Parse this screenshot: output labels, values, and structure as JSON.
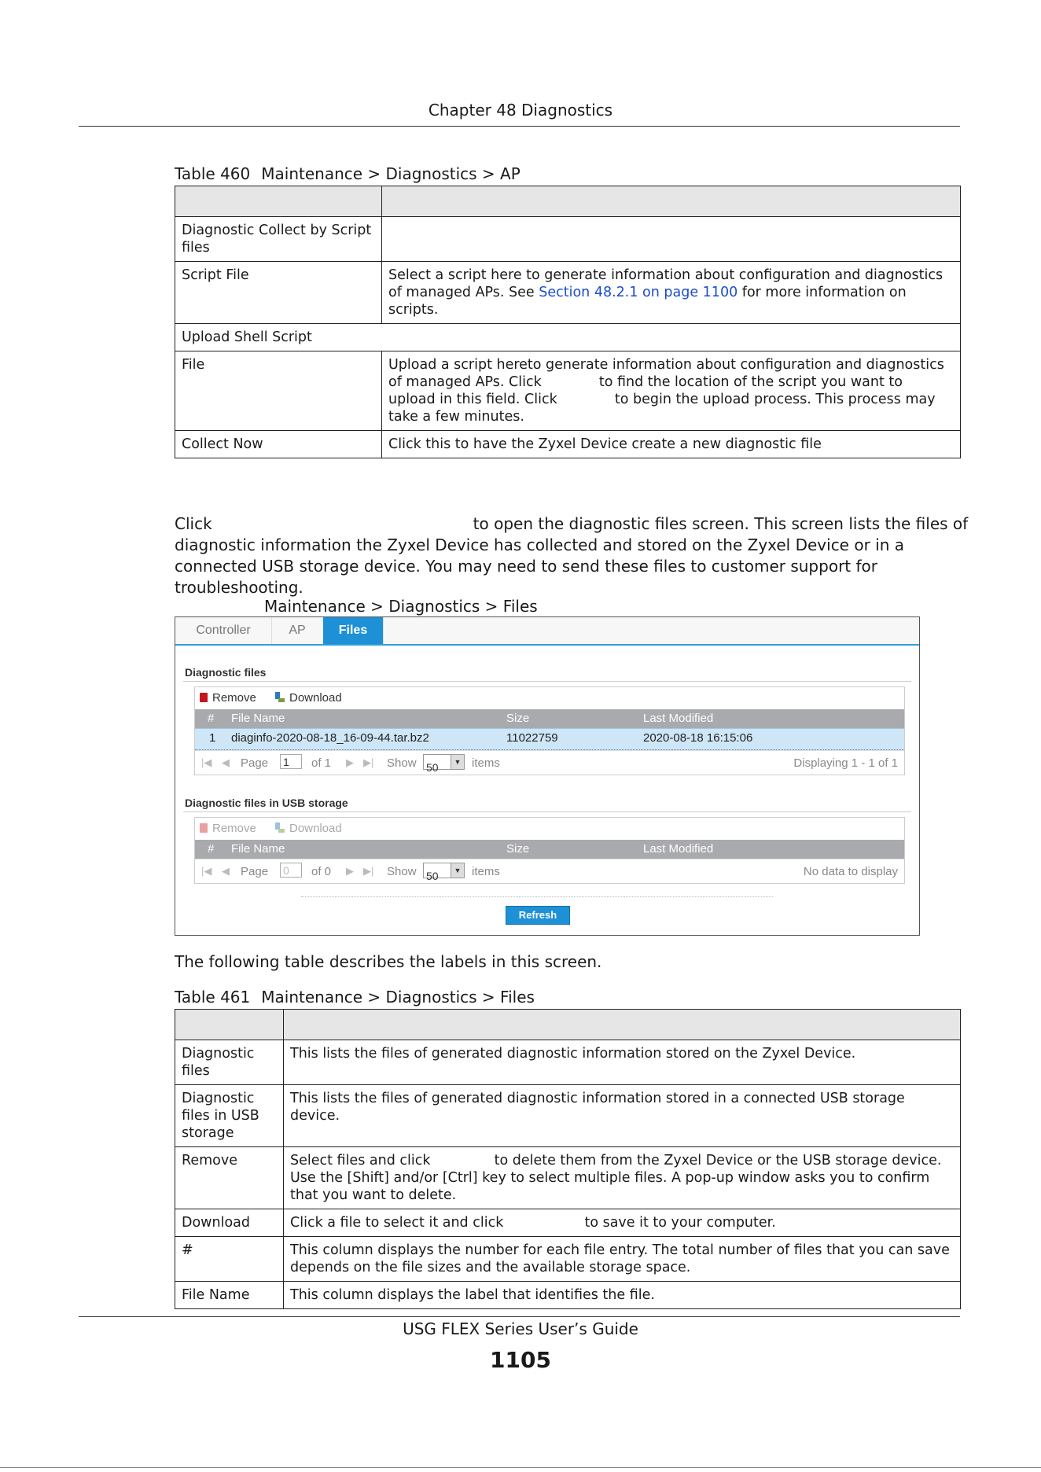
{
  "header": {
    "chapter_title": "Chapter 48 Diagnostics"
  },
  "table460": {
    "caption_num": "Table 460",
    "caption_title": "Maintenance > Diagnostics > AP",
    "rows": [
      {
        "label": "Diagnostic Collect by Script files",
        "desc": ""
      },
      {
        "label": "Script File",
        "desc_pre": "Select a script here to generate information about configuration and diagnostics of managed APs. See ",
        "link": "Section 48.2.1 on page 1100",
        "desc_post": " for more information on scripts."
      },
      {
        "label": "Upload Shell Script"
      },
      {
        "label": "File",
        "desc_a": "Upload a script hereto generate information about configuration and diagnostics of managed APs. Click ",
        "desc_b": " to find the location of the script you want to upload in this field. Click ",
        "desc_c": " to begin the upload process. This process may take a few minutes."
      },
      {
        "label": "Collect Now",
        "desc": "Click this to have the Zyxel Device create a new diagnostic file"
      }
    ]
  },
  "intro": {
    "click": "Click",
    "text": "to open the diagnostic files screen. This screen lists the files of diagnostic information the Zyxel Device has collected and stored on the Zyxel Device or in a connected USB storage device. You may need to send these files to customer support for troubleshooting."
  },
  "figure": {
    "caption_title": "Maintenance > Diagnostics > Files"
  },
  "screen": {
    "tabs": [
      "Controller",
      "AP",
      "Files"
    ],
    "section1_title": "Diagnostic files",
    "section2_title": "Diagnostic files in USB storage",
    "remove_label": "Remove",
    "download_label": "Download",
    "columns": [
      "#",
      "File Name",
      "Size",
      "Last Modified"
    ],
    "files": [
      {
        "num": "1",
        "name": "diaginfo-2020-08-18_16-09-44.tar.bz2",
        "size": "11022759",
        "modified": "2020-08-18 16:15:06"
      }
    ],
    "pager1": {
      "page_label": "Page",
      "page_value": "1",
      "of_label": "of 1",
      "show_label": "Show",
      "show_value": "50",
      "items_label": "items",
      "status": "Displaying 1 - 1 of 1"
    },
    "pager2": {
      "page_label": "Page",
      "page_value": "0",
      "of_label": "of 0",
      "show_label": "Show",
      "show_value": "50",
      "items_label": "items",
      "status": "No data to display"
    },
    "refresh_label": "Refresh"
  },
  "following_text": "The following table describes the labels in this screen.",
  "table461": {
    "caption_num": "Table 461",
    "caption_title": "Maintenance > Diagnostics > Files",
    "rows": [
      {
        "label": "Diagnostic files",
        "desc": "This lists the files of generated diagnostic information stored on the Zyxel Device."
      },
      {
        "label": "Diagnostic files in USB storage",
        "desc": "This lists the files of generated diagnostic information stored in a connected USB storage device."
      },
      {
        "label": "Remove",
        "desc_a": "Select files and click ",
        "desc_b": " to delete them from the Zyxel Device or the USB storage device. Use the [Shift] and/or [Ctrl] key to select multiple files. A pop-up window asks you to confirm that you want to delete."
      },
      {
        "label": "Download",
        "desc_a": "Click a file to select it and click ",
        "desc_b": " to save it to your computer."
      },
      {
        "label": "#",
        "desc": "This column displays the number for each file entry. The total number of files that you can save depends on the file sizes and the available storage space."
      },
      {
        "label": "File Name",
        "desc": "This column displays the label that identifies the file."
      }
    ]
  },
  "footer": {
    "guide_title": "USG FLEX Series User’s Guide",
    "page_number": "1105"
  }
}
